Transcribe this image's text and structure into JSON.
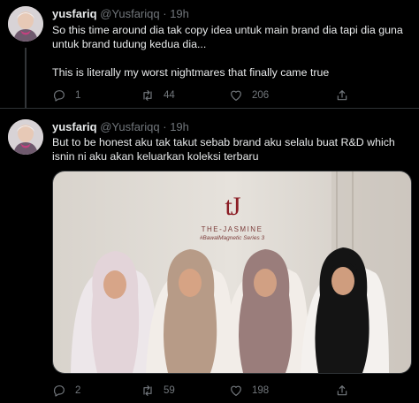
{
  "tweets": [
    {
      "name": "yusfariq",
      "handle": "@Yusfariqq",
      "sep": "·",
      "time": "19h",
      "text": "So this time around dia tak copy idea untuk main brand dia tapi dia guna untuk brand tudung kedua dia...\n\nThis is literally my worst nightmares that finally came true",
      "replies": "1",
      "retweets": "44",
      "likes": "206"
    },
    {
      "name": "yusfariq",
      "handle": "@Yusfariqq",
      "sep": "·",
      "time": "19h",
      "text": "But to be honest aku tak takut sebab brand aku selalu buat R&D which isnin ni aku akan keluarkan koleksi terbaru",
      "replies": "2",
      "retweets": "59",
      "likes": "198",
      "media": {
        "logo": "tJ",
        "brand_name": "THE-JASMINE",
        "series": "#BawalMagnetic Series 3"
      }
    }
  ],
  "icons": {
    "reply": "reply-icon",
    "retweet": "retweet-icon",
    "like": "heart-icon",
    "share": "share-icon"
  },
  "colors": {
    "background": "#000000",
    "text": "#e7e9ea",
    "secondary": "#71767b",
    "divider": "#2f3336",
    "brand_logo": "#8b1c24"
  }
}
